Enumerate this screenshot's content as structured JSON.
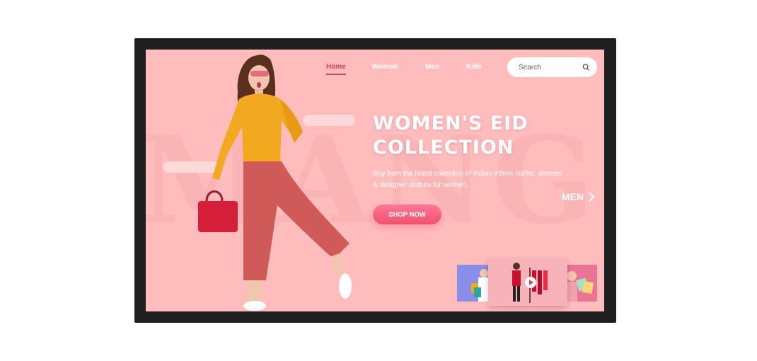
{
  "colors": {
    "frame": "#1f1f1f",
    "background": "#ffbcbd",
    "accent": "#d93f5b",
    "button": "#f0506f"
  },
  "nav": {
    "items": [
      {
        "label": "Home",
        "active": true
      },
      {
        "label": "Women",
        "active": false
      },
      {
        "label": "Men",
        "active": false
      },
      {
        "label": "Kids",
        "active": false
      }
    ]
  },
  "search": {
    "placeholder": "Search",
    "icon": "search-icon"
  },
  "hero": {
    "title_line1": "WOMEN'S EID",
    "title_line2": "COLLECTION",
    "description": "Buy from the latest collection of Indian ethnic outfits, dresses & designer clothes for women.",
    "cta_label": "SHOP NOW",
    "next_label": "MEN"
  }
}
